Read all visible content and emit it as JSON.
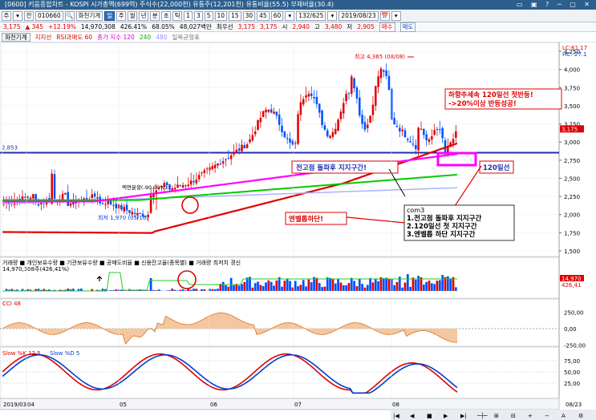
{
  "window": {
    "title": "[0600] 키움종합차트 - KOSPI 시가총액(699억) 주식수(22,000천) 유통주(12,201천) 유통비율(55.5) 부채비율(30.4)",
    "buttons": "▭ ▣ ? ─ ▢ ✕"
  },
  "toolbar": {
    "items": [
      "주",
      "▾",
      "전",
      "010660",
      "🔍",
      "화천기계",
      "일",
      "주",
      "월",
      "년",
      "분",
      "초",
      "틱",
      "1",
      "3",
      "5",
      "10",
      "15",
      "30",
      "45",
      "60",
      "▾",
      "132/625",
      "▾",
      "2019/08/23",
      "📅",
      "▾"
    ]
  },
  "quote": {
    "price": "3,175",
    "change": "345",
    "pct": "+12.19%",
    "volume": "14,970,308",
    "vol_pct": "426.41%",
    "turnover": "68.05%",
    "amount": "48,027백만",
    "trend": "최우선",
    "best": "3,175",
    "best2": "3,175",
    "open_label": "시",
    "open": "2,940",
    "high_label": "고",
    "high": "3,480",
    "low_label": "저",
    "low": "2,905",
    "buy": "매수",
    "sell": "매도"
  },
  "chart_tabs": {
    "chart_label": "화천기계",
    "indicators": [
      "지지선",
      "RSI과매도 60",
      "종가 지수 120",
      "240",
      "480",
      "일목균형표"
    ]
  },
  "price_panel": {
    "ylabels": [
      "4,250",
      "4,000",
      "3,750",
      "3,500",
      "3,250",
      "3,000",
      "2,750",
      "2,500",
      "2,250",
      "2,000",
      "1,750",
      "1,500"
    ],
    "ref_line": "2,853",
    "right_tags": [
      "LC:61.17",
      "HC:-27.1"
    ],
    "price_tags": [
      "3,175",
      "3,175"
    ],
    "annot_high": "최고 4,365 (08/08)",
    "annot_low": "최저 1,970 (05/16)",
    "annot_split": "액면분할(-90.00%)",
    "box_red": "하향추세속 120일선 첫반등!\n->20%이상 반등성공!",
    "box_blue": "전고점 돌파후 지지구간!",
    "box_120": "120일선",
    "box_env": "엔벨롭하단!",
    "com_title": "com3",
    "com_lines": [
      "1.전고점 돌파후 지지구간",
      "2.120일선 첫 지지구간",
      "3.엔벨롭 하단 지지구간"
    ]
  },
  "volume_panel": {
    "header": "거래량 ■ 개인보유수량 ■ 기관보유수량 ■ 공매도비율 ■ 신용잔고율(종목별) ■ 거래량 최저치 경신",
    "sub": "14,970,308주(426,41%)",
    "tags": [
      "14,970",
      "426,41"
    ]
  },
  "cci_panel": {
    "header": "CCI 48",
    "ylabels": [
      "250,00",
      "0,00",
      "-250,00"
    ]
  },
  "slow_panel": {
    "header_k": "Slow %K 12,5",
    "header_d": "Slow %D 5",
    "ylabels": [
      "75,00",
      "50,00",
      "25,00"
    ]
  },
  "xaxis": {
    "labels": [
      "2019/03",
      "04",
      "05",
      "06",
      "07",
      "08"
    ],
    "end": "08/23"
  },
  "colors": {
    "up": "#e00000",
    "down": "#0050ff",
    "ma120": "#ff00ff",
    "ma240": "#00cc00",
    "ma480": "#b0b0ff",
    "env": "#e00000"
  }
}
